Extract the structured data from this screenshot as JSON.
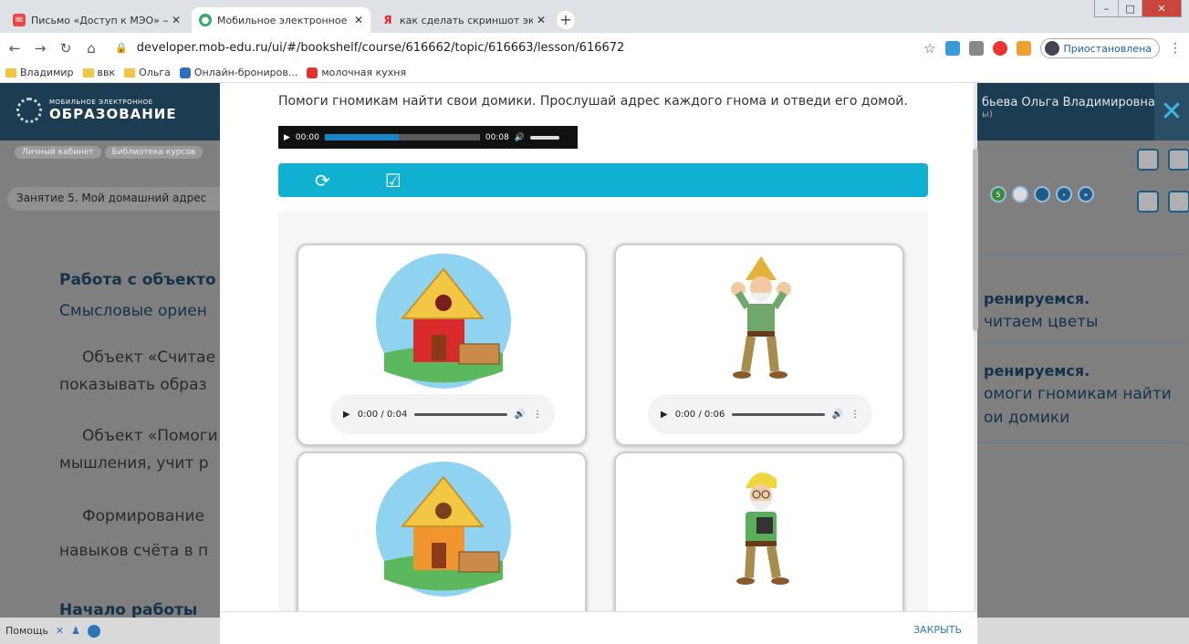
{
  "browser": {
    "tabs": [
      {
        "title": "Письмо «Доступ к МЭО» — Ро"
      },
      {
        "title": "Мобильное электронное обра"
      },
      {
        "title": "как сделать скриншот экрана н"
      }
    ],
    "url": "developer.mob-edu.ru/ui/#/bookshelf/course/616662/topic/616663/lesson/616672",
    "profile_label": "Приостановлена",
    "bookmarks": [
      "Владимир",
      "ввк",
      "Ольга",
      "Онлайн-брониров...",
      "молочная кухня"
    ]
  },
  "site": {
    "logo_small": "МОБИЛЬНОЕ ЭЛЕКТРОННОЕ",
    "logo_big": "ОБРАЗОВАНИЕ",
    "user_name": "бьева Ольга Владимировна",
    "user_sub": "ы)",
    "breadcrumbs": [
      "Личный кабинет",
      "Библиотека курсов"
    ],
    "lesson_title": "Занятие 5. Мой домашний адрес",
    "step_number": "5",
    "bg_left": [
      "Работа с объекто",
      "Смысловые ориен",
      "Объект «Считае",
      "показывать образ",
      "Объект «Помоги",
      "мышления, учит р",
      "Формирование",
      "навыков счёта в п",
      "Начало работы"
    ],
    "bg_right": [
      "ренируемся.",
      "читаем цветы",
      "ренируемся.",
      "омоги гномикам найти",
      "ои домики"
    ],
    "help_label": "Помощь"
  },
  "modal": {
    "instruction": "Помоги гномикам найти свои домики. Прослушай адрес каждого гнома и отведи его домой.",
    "main_audio": {
      "current": "00:00",
      "duration": "00:08",
      "progress": 0.48
    },
    "cards": [
      {
        "kind": "house",
        "roof": "red",
        "audio": "0:00 / 0:04"
      },
      {
        "kind": "gnome",
        "variant": "strong",
        "audio": "0:00 / 0:06"
      },
      {
        "kind": "house",
        "roof": "orange",
        "audio": ""
      },
      {
        "kind": "gnome",
        "variant": "glasses",
        "audio": ""
      }
    ],
    "close_label": "ЗАКРЫТЬ"
  }
}
